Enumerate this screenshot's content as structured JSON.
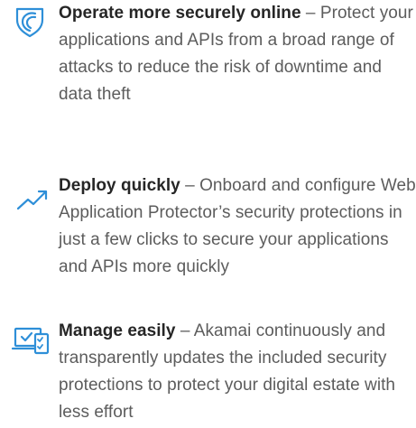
{
  "accent_color": "#2e8fd8",
  "benefits": [
    {
      "icon": "shield-icon",
      "title": "Operate more securely online",
      "separator": " – ",
      "description": "Protect your applications and APIs from a broad range of attacks to reduce the risk of downtime and data theft"
    },
    {
      "icon": "trending-up-icon",
      "title": "Deploy quickly",
      "separator": " – ",
      "description": "Onboard and configure Web Application Protector’s security protections in just a few clicks to secure your applications and APIs more quickly"
    },
    {
      "icon": "devices-checklist-icon",
      "title": "Manage easily",
      "separator": " – ",
      "description": "Akamai continuously and transparently updates the included security protections to protect your digital estate with less effort"
    }
  ]
}
